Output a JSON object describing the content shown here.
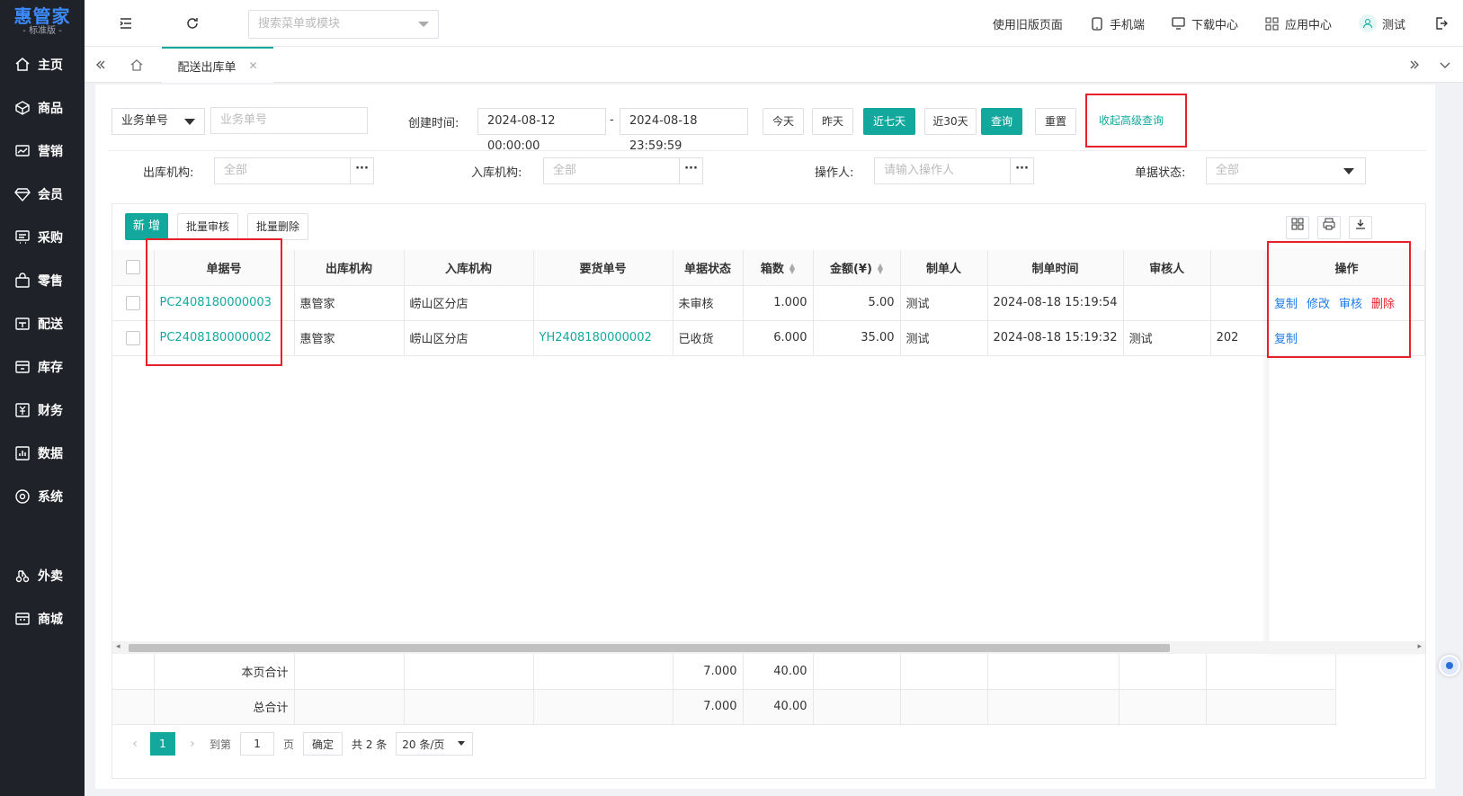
{
  "logo": {
    "main": "惠管家",
    "sub": "- 标准版 -"
  },
  "sidebar": {
    "items": [
      {
        "label": "主页",
        "icon": "home-icon"
      },
      {
        "label": "商品",
        "icon": "cube-icon"
      },
      {
        "label": "营销",
        "icon": "chart-icon"
      },
      {
        "label": "会员",
        "icon": "diamond-icon"
      },
      {
        "label": "采购",
        "icon": "cart-icon"
      },
      {
        "label": "零售",
        "icon": "bag-icon"
      },
      {
        "label": "配送",
        "icon": "truck-icon"
      },
      {
        "label": "库存",
        "icon": "warehouse-icon"
      },
      {
        "label": "财务",
        "icon": "finance-icon"
      },
      {
        "label": "数据",
        "icon": "data-icon"
      },
      {
        "label": "系统",
        "icon": "settings-icon"
      },
      {
        "label": "外卖",
        "icon": "delivery-icon"
      },
      {
        "label": "商城",
        "icon": "mall-icon"
      }
    ]
  },
  "topbar": {
    "search_placeholder": "搜索菜单或模块",
    "old_page": "使用旧版页面",
    "mobile": "手机端",
    "download": "下载中心",
    "apps": "应用中心",
    "user": "测试"
  },
  "tabs": {
    "active": "配送出库单"
  },
  "filters": {
    "type_select": "业务单号",
    "order_placeholder": "业务单号",
    "created_label": "创建时间:",
    "date_start": "2024-08-12 00:00:00",
    "date_sep": "-",
    "date_end": "2024-08-18 23:59:59",
    "today": "今天",
    "yesterday": "昨天",
    "last7": "近七天",
    "last30": "近30天",
    "query": "查询",
    "reset": "重置",
    "collapse": "收起高级查询",
    "out_org_label": "出库机构:",
    "out_org_placeholder": "全部",
    "in_org_label": "入库机构:",
    "in_org_placeholder": "全部",
    "operator_label": "操作人:",
    "operator_placeholder": "请输入操作人",
    "status_label": "单据状态:",
    "status_placeholder": "全部",
    "dots": "···"
  },
  "toolbar": {
    "add": "新 增",
    "batch_audit": "批量审核",
    "batch_delete": "批量删除"
  },
  "table": {
    "headers": {
      "order_no": "单据号",
      "out_org": "出库机构",
      "in_org": "入库机构",
      "req_no": "要货单号",
      "status": "单据状态",
      "boxes": "箱数",
      "amount": "金额(¥)",
      "maker": "制单人",
      "made_time": "制单时间",
      "auditor": "审核人",
      "ops": "操作"
    },
    "rows": [
      {
        "order_no": "PC2408180000003",
        "out_org": "惠管家",
        "in_org": "崂山区分店",
        "req_no": "",
        "status": "未审核",
        "boxes": "1.000",
        "amount": "5.00",
        "maker": "测试",
        "made_time": "2024-08-18 15:19:54",
        "auditor": "",
        "extra": "",
        "ops": [
          "复制",
          "修改",
          "审核",
          "删除"
        ]
      },
      {
        "order_no": "PC2408180000002",
        "out_org": "惠管家",
        "in_org": "崂山区分店",
        "req_no": "YH2408180000002",
        "status": "已收货",
        "boxes": "6.000",
        "amount": "35.00",
        "maker": "测试",
        "made_time": "2024-08-18 15:19:32",
        "auditor": "测试",
        "extra": "202",
        "ops": [
          "复制"
        ]
      }
    ],
    "summary": [
      {
        "label": "本页合计",
        "boxes": "7.000",
        "amount": "40.00"
      },
      {
        "label": "总合计",
        "boxes": "7.000",
        "amount": "40.00"
      }
    ]
  },
  "pager": {
    "current": "1",
    "goto_label": "到第",
    "goto_value": "1",
    "page_unit": "页",
    "confirm": "确定",
    "total": "共 2 条",
    "page_size": "20 条/页"
  }
}
